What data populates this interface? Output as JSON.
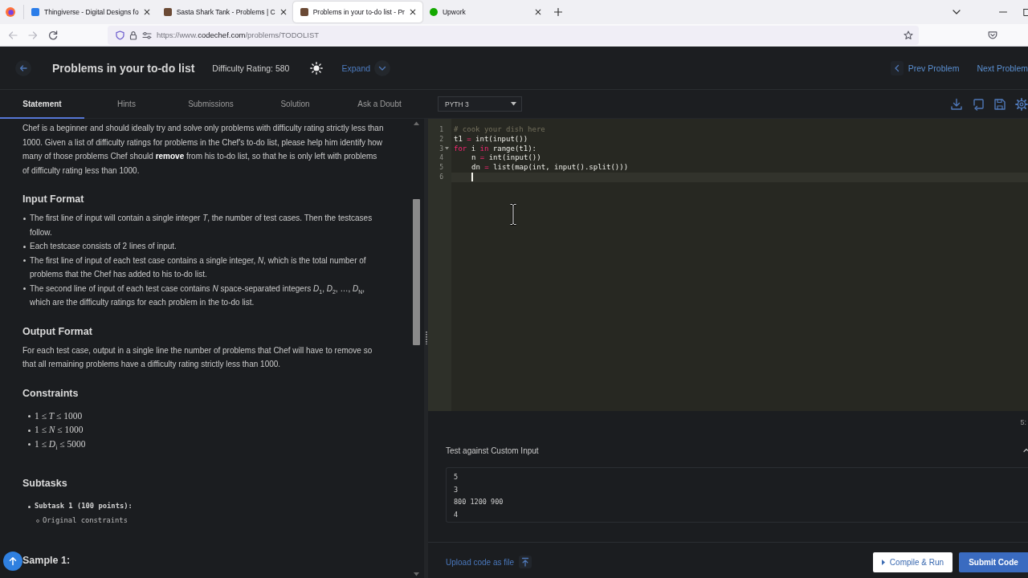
{
  "browser": {
    "tabs": [
      {
        "title": "Thingiverse - Digital Designs fo",
        "kind": "square",
        "color": "#2b7de9",
        "selected": false
      },
      {
        "title": "Sasta Shark Tank - Problems | C",
        "kind": "square",
        "color": "#6b4a35",
        "selected": false
      },
      {
        "title": "Problems in your to-do list - Pr",
        "kind": "square",
        "color": "#6b4a35",
        "selected": true
      },
      {
        "title": "Upwork",
        "kind": "circle",
        "color": "#14a800",
        "selected": false
      }
    ],
    "url": "https://www.**codechef.com**/problems/TODOLIST"
  },
  "problem": {
    "title": "Problems in your to-do list",
    "difficulty": "Difficulty Rating: 580",
    "expand": "Expand",
    "prev": "Prev Problem",
    "next": "Next Problem"
  },
  "panel_tabs": [
    {
      "label": "Statement",
      "selected": true
    },
    {
      "label": "Hints",
      "selected": false
    },
    {
      "label": "Submissions",
      "selected": false
    },
    {
      "label": "Solution",
      "selected": false
    },
    {
      "label": "Ask a Doubt",
      "selected": false
    }
  ],
  "statement": [
    {
      "kind": "paragraph",
      "text": "Chef is a beginner and should ideally try and solve only problems with difficulty rating strictly less than 1000. Given a list of difficulty ratings for problems in the Chef's to-do list, please help him identify how many of those problems Chef should **remove** from his to-do list, so that he is only left with problems of difficulty rating less than 1000."
    },
    {
      "kind": "heading",
      "text": "Input Format"
    },
    {
      "kind": "list",
      "items": [
        "The first line of input will contain a single integer *T*, the number of test cases. Then the testcases follow.",
        "Each testcase consists of 2 lines of input.",
        "The first line of input of each test case contains a single integer, *N*, which is the total number of problems that the Chef has added to his to-do list.",
        "The second line of input of each test case contains *N* space-separated integers *D*$_{1}$, *D*$_{2}$, …, *D*$_{N}$, which are the difficulty ratings for each problem in the to-do list."
      ]
    },
    {
      "kind": "heading",
      "text": "Output Format"
    },
    {
      "kind": "paragraph",
      "text": "For each test case, output in a single line the number of problems that Chef will have to remove so that all remaining problems have a difficulty rating strictly less than 1000."
    },
    {
      "kind": "heading",
      "text": "Constraints"
    },
    {
      "kind": "math_list",
      "items": [
        "1 ≤ *T* ≤ 1000",
        "1 ≤ *N* ≤ 1000",
        "1 ≤ *D*$_{i}$ ≤ 5000"
      ]
    },
    {
      "kind": "heading",
      "text": "Subtasks"
    },
    {
      "kind": "code_list",
      "items": [
        {
          "text": "Subtask 1 (100 points):",
          "children": [
            {
              "text": "Original constraints"
            }
          ]
        }
      ]
    },
    {
      "kind": "heading",
      "text": "Sample 1:"
    }
  ],
  "editor": {
    "language": "PYTH 3",
    "status": "5:",
    "lines": [
      {
        "number": "1",
        "active": false,
        "fold_marker": false,
        "tokens": [
          {
            "text": "# cook your dish here",
            "kind": "comment"
          }
        ]
      },
      {
        "number": "2",
        "active": false,
        "fold_marker": false,
        "tokens": [
          {
            "text": "t1 ",
            "kind": "plain"
          },
          {
            "text": "=",
            "kind": "operator"
          },
          {
            "text": " int(input())",
            "kind": "plain"
          }
        ]
      },
      {
        "number": "3",
        "active": false,
        "fold_marker": true,
        "tokens": [
          {
            "text": "for",
            "kind": "keyword"
          },
          {
            "text": " i ",
            "kind": "plain"
          },
          {
            "text": "in",
            "kind": "keyword"
          },
          {
            "text": " range(t1):",
            "kind": "plain"
          }
        ],
        "children": [
          {
            "number": "4",
            "active": false,
            "fold_marker": false,
            "tokens": [
              {
                "text": "n ",
                "kind": "plain"
              },
              {
                "text": "=",
                "kind": "operator"
              },
              {
                "text": " int(input())",
                "kind": "plain"
              }
            ]
          },
          {
            "number": "5",
            "active": false,
            "fold_marker": false,
            "tokens": [
              {
                "text": "dn ",
                "kind": "plain"
              },
              {
                "text": "=",
                "kind": "operator"
              },
              {
                "text": " list(map(int, input().split()))",
                "kind": "plain"
              }
            ]
          },
          {
            "number": "6",
            "active": true,
            "fold_marker": false
          }
        ]
      }
    ]
  },
  "custom_input": {
    "title": "Test against Custom Input",
    "value": "5\n3\n800 1200 900\n4"
  },
  "upload": "Upload code as file",
  "actions": [
    {
      "label": "Compile & Run",
      "kind": "secondary"
    },
    {
      "label": "Submit Code",
      "kind": "primary"
    }
  ]
}
